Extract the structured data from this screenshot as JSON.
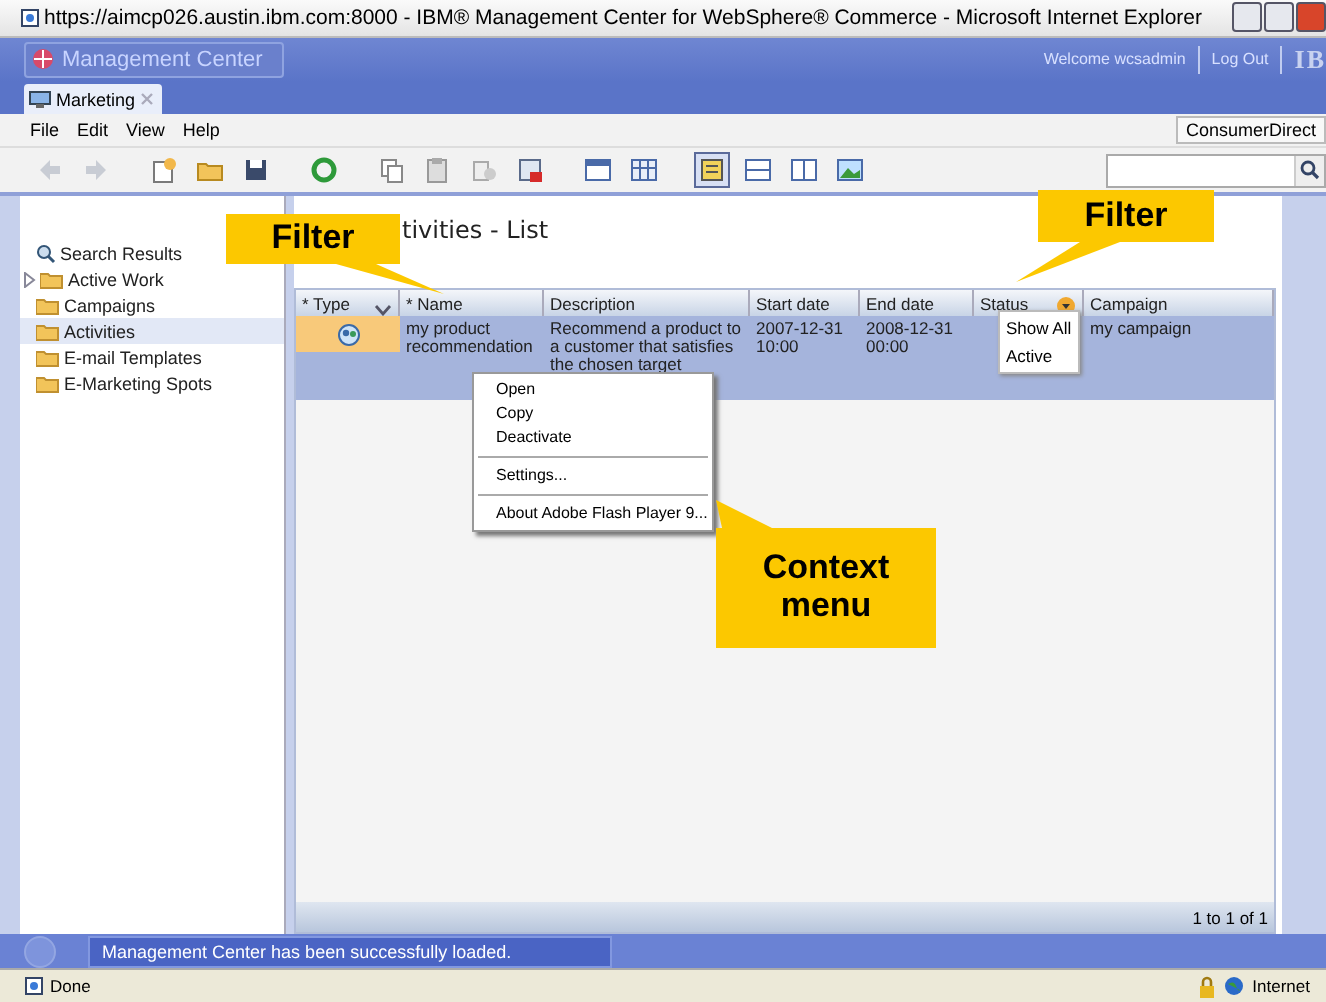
{
  "window": {
    "title": "https://aimcp026.austin.ibm.com:8000 - IBM® Management Center for WebSphere® Commerce - Microsoft Internet Explorer"
  },
  "app_header": {
    "title": "Management Center",
    "welcome": "Welcome wcsadmin",
    "logout": "Log Out",
    "logo": "IB"
  },
  "tabs": [
    {
      "label": "Marketing",
      "selected": true
    }
  ],
  "menu": [
    "File",
    "Edit",
    "View",
    "Help"
  ],
  "store": "ConsumerDirect",
  "toolbar": [
    {
      "kind": "back",
      "selected": false
    },
    {
      "kind": "forward",
      "selected": false
    },
    {
      "kind": "new",
      "selected": false
    },
    {
      "kind": "folder",
      "selected": false
    },
    {
      "kind": "save",
      "selected": false
    },
    {
      "kind": "refresh",
      "selected": false
    },
    {
      "kind": "copy",
      "selected": false
    },
    {
      "kind": "paste",
      "selected": false
    },
    {
      "kind": "duplicate",
      "selected": false
    },
    {
      "kind": "delete",
      "selected": false
    },
    {
      "kind": "window",
      "selected": false
    },
    {
      "kind": "table",
      "selected": false
    },
    {
      "kind": "details",
      "selected": true
    },
    {
      "kind": "rows",
      "selected": false
    },
    {
      "kind": "columns",
      "selected": false
    },
    {
      "kind": "image",
      "selected": false
    }
  ],
  "tree": [
    {
      "label": "Search Results",
      "kind": "search",
      "selected": false
    },
    {
      "label": "Active Work",
      "kind": "expandable",
      "selected": false
    },
    {
      "label": "Campaigns",
      "kind": "folder",
      "selected": false
    },
    {
      "label": "Activities",
      "kind": "folder",
      "selected": true
    },
    {
      "label": "E-mail Templates",
      "kind": "folder",
      "selected": false
    },
    {
      "label": "E-Marketing Spots",
      "kind": "folder",
      "selected": false
    }
  ],
  "list": {
    "title": "tivities - List",
    "columns": [
      {
        "label": "* Type",
        "filter": true
      },
      {
        "label": "* Name",
        "filter": false
      },
      {
        "label": "Description",
        "filter": false
      },
      {
        "label": "Start date",
        "filter": false
      },
      {
        "label": "End date",
        "filter": false
      },
      {
        "label": "Status",
        "filter": true
      },
      {
        "label": "Campaign",
        "filter": false
      }
    ],
    "rows": [
      {
        "selected": true,
        "cells": [
          "",
          "my product recommendation",
          "Recommend a product to a customer that satisfies the chosen target",
          "2007-12-31 10:00",
          "2008-12-31 00:00",
          "",
          "my campaign"
        ]
      }
    ],
    "footer": "1 to 1 of 1"
  },
  "status_filter_menu": [
    "Show All",
    "Active"
  ],
  "context_menu": [
    {
      "kind": "item",
      "label": "Open"
    },
    {
      "kind": "item",
      "label": "Copy"
    },
    {
      "kind": "item",
      "label": "Deactivate"
    },
    {
      "kind": "separator"
    },
    {
      "kind": "item",
      "label": "Settings..."
    },
    {
      "kind": "separator"
    },
    {
      "kind": "item",
      "label": "About Adobe Flash Player 9..."
    }
  ],
  "status_message": "Management Center has been successfully loaded.",
  "browser_status": {
    "text": "Done",
    "zone": "Internet"
  },
  "callouts": [
    "Filter",
    "Filter",
    "Context menu"
  ]
}
